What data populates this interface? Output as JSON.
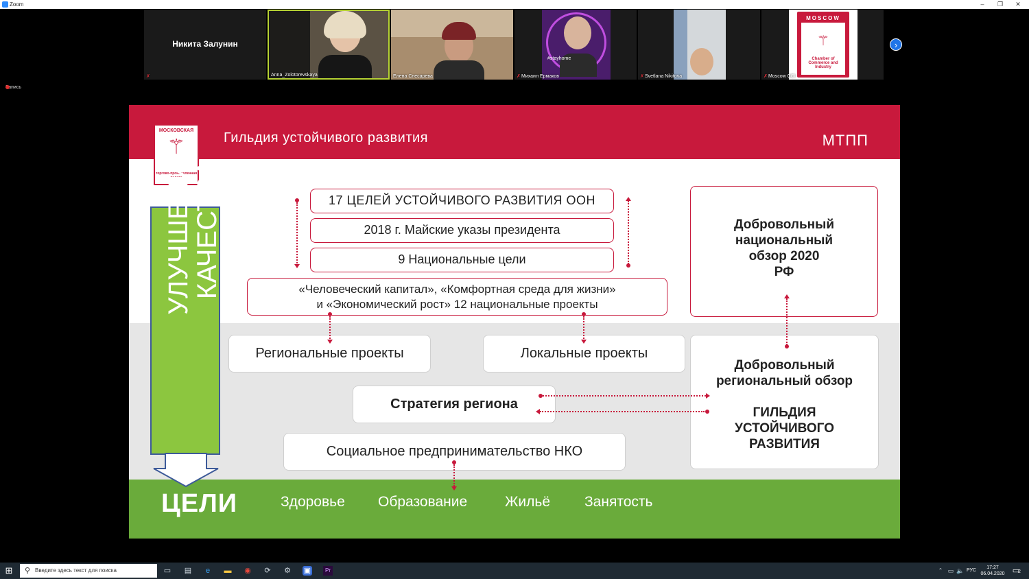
{
  "window": {
    "title": "Zoom",
    "controls": [
      "–",
      "❐",
      "✕"
    ]
  },
  "gallery": {
    "tiles": [
      {
        "name": "Никита Залунин",
        "label": "",
        "type": "name-only"
      },
      {
        "name": "",
        "label": "Anna_Zolotorevskaya",
        "type": "video",
        "bg": "#5b5244"
      },
      {
        "name": "",
        "label": "Елена Снесарева",
        "type": "video",
        "bg": "#a88d6e"
      },
      {
        "name": "",
        "label": "Михаил Ермаков",
        "type": "video",
        "bg": "#4a1d6b",
        "overlay": "#stayhome"
      },
      {
        "name": "",
        "label": "Svetlana Nikitova",
        "type": "video",
        "bg": "#7d8fa6"
      },
      {
        "name": "",
        "label": "Moscow CCI",
        "type": "logo",
        "logo_top": "MOSCOW",
        "logo_bottom": "Chamber of Commerce and Industry"
      }
    ],
    "next_icon": "chevron-right-icon"
  },
  "recording": {
    "label": "Запись"
  },
  "slide": {
    "title": "Гильдия устойчивого развития",
    "org": "МТПП",
    "logo": {
      "top": "МОСКОВСКАЯ",
      "bottom": "торгово-промышленная палата"
    },
    "vertical_text": [
      "УЛУЧШЕНИЕ",
      "КАЧЕСТВА ЖИЗНИ"
    ],
    "boxes": {
      "un_goals": "17 ЦЕЛЕЙ УСТОЙЧИВОГО РАЗВИТИЯ ООН",
      "may_decrees": "2018 г. Майские указы президента",
      "national_goals": "9 Национальные цели",
      "national_projects_1": "«Человеческий капитал», «Комфортная среда для жизни»",
      "national_projects_2": "и «Экономический рост» 12 национальные проекты",
      "voluntary_national": [
        "Добровольный",
        "национальный",
        "обзор 2020",
        "РФ"
      ],
      "regional_projects": "Региональные проекты",
      "local_projects": "Локальные проекты",
      "region_strategy": "Стратегия региона",
      "social_entrepreneurship": "Социальное предпринимательство НКО",
      "voluntary_regional": [
        "Добровольный",
        "региональный обзор"
      ],
      "guild": [
        "ГИЛЬДИЯ",
        "УСТОЙЧИВОГО",
        "РАЗВИТИЯ"
      ]
    },
    "goals_label": "ЦЕЛИ",
    "goals": [
      "Здоровье",
      "Образование",
      "Жильё",
      "Занятость"
    ],
    "colors": {
      "brand_red": "#c8193c",
      "green": "#6aab3b",
      "light_green": "#8cc63f",
      "band_grey": "#e6e6e6"
    }
  },
  "taskbar": {
    "search_placeholder": "Введите здесь текст для поиска",
    "icons": [
      "task-view-icon",
      "file-explorer-icon",
      "edge-icon",
      "folder-icon",
      "chrome-icon",
      "update-icon",
      "settings-icon",
      "zoom-app-icon",
      "premiere-icon"
    ],
    "language": "РУС",
    "time": "17:27",
    "date": "06.04.2020",
    "notifications": "2"
  }
}
